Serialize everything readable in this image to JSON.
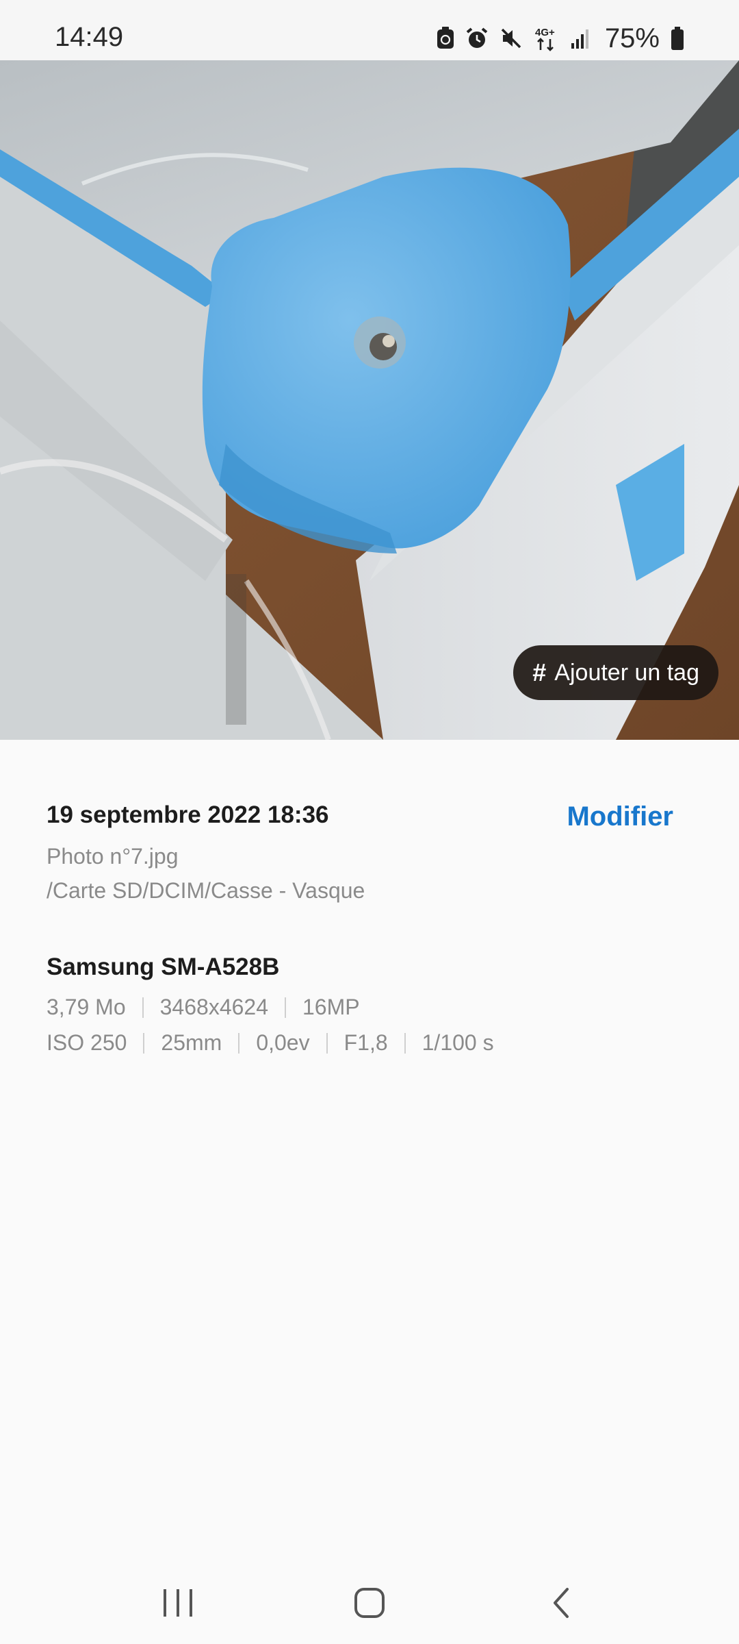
{
  "status_bar": {
    "time": "14:49",
    "battery_percent": "75%",
    "network": "4G+",
    "icons": [
      "android-system-icon",
      "alarm-icon",
      "mute-icon",
      "network-4g-icon",
      "signal-icon",
      "battery-icon"
    ]
  },
  "photo": {
    "tag_button": {
      "icon": "#",
      "label": "Ajouter un tag"
    }
  },
  "details": {
    "date": "19 septembre 2022 18:36",
    "modify_label": "Modifier",
    "file_name": "Photo n°7.jpg",
    "file_path": "/Carte SD/DCIM/Casse - Vasque",
    "device": "Samsung SM-A528B",
    "row1": [
      "3,79 Mo",
      "3468x4624",
      "16MP"
    ],
    "row2": [
      "ISO 250",
      "25mm",
      "0,0ev",
      "F1,8",
      "1/100 s"
    ]
  },
  "nav_bar": {
    "buttons": [
      "recent-apps",
      "home",
      "back"
    ]
  },
  "colors": {
    "accent": "#1877cc",
    "background": "#fafafa",
    "muted_text": "#8a8a8a"
  }
}
